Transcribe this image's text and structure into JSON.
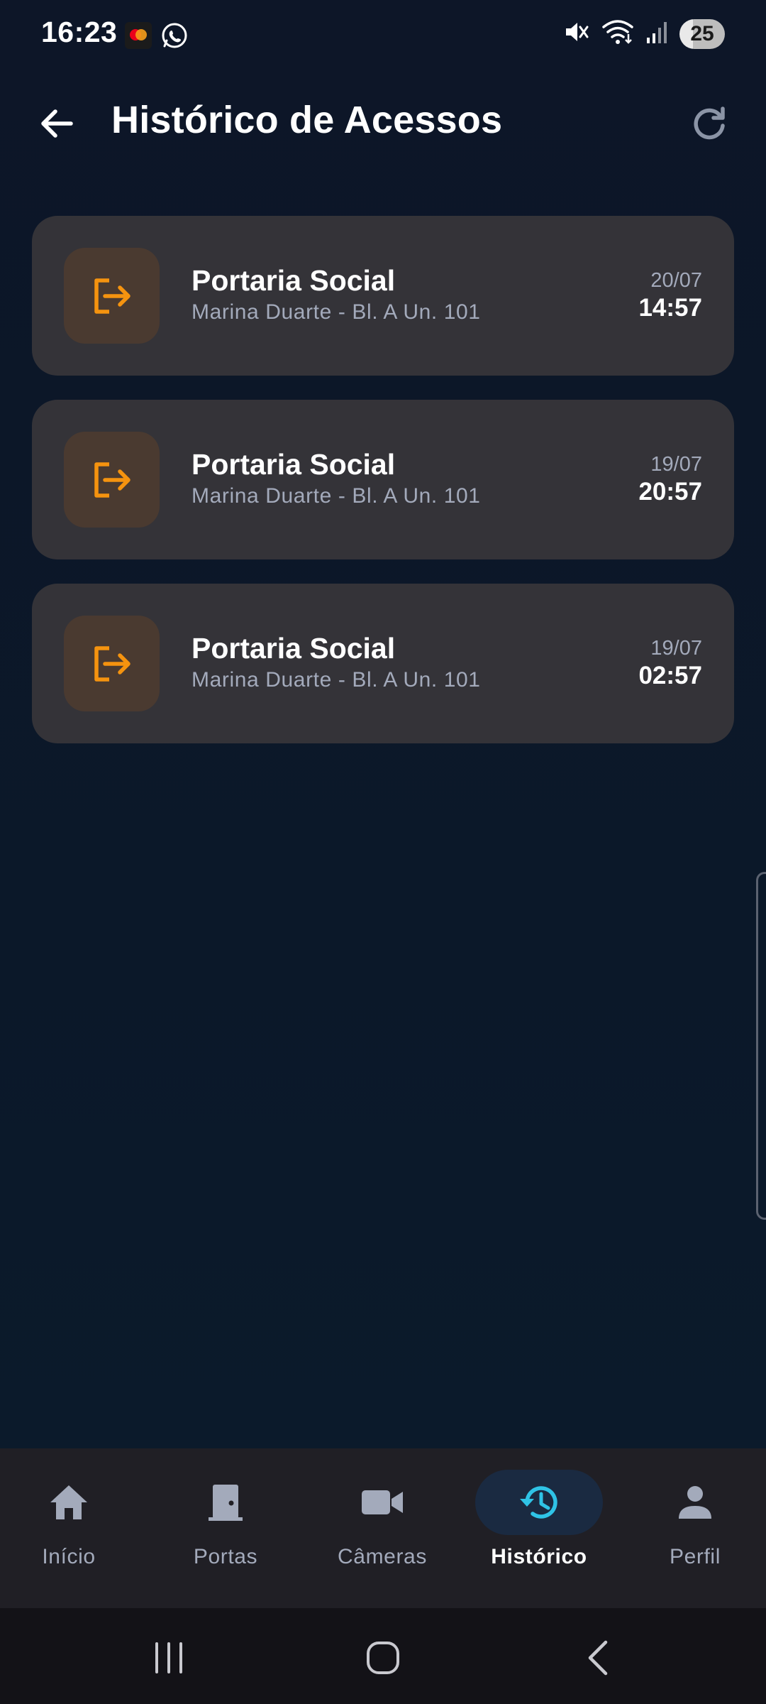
{
  "status_bar": {
    "time": "16:23",
    "battery": "25",
    "icons": [
      "mastercard-icon",
      "whatsapp-icon",
      "mute-icon",
      "wifi-icon",
      "signal-icon",
      "battery-icon"
    ]
  },
  "header": {
    "title": "Histórico de Acessos",
    "back_icon": "arrow-left-icon",
    "refresh_icon": "refresh-icon"
  },
  "access_list": [
    {
      "title": "Portaria Social",
      "subtitle": "Marina Duarte - Bl. A Un. 101",
      "date": "20/07",
      "time": "14:57",
      "icon": "exit-icon"
    },
    {
      "title": "Portaria Social",
      "subtitle": "Marina Duarte - Bl. A Un. 101",
      "date": "19/07",
      "time": "20:57",
      "icon": "exit-icon"
    },
    {
      "title": "Portaria Social",
      "subtitle": "Marina Duarte - Bl. A Un. 101",
      "date": "19/07",
      "time": "02:57",
      "icon": "exit-icon"
    }
  ],
  "bottom_nav": {
    "active": "Histórico",
    "items": [
      {
        "label": "Início",
        "icon": "home-icon"
      },
      {
        "label": "Portas",
        "icon": "door-icon"
      },
      {
        "label": "Câmeras",
        "icon": "videocam-icon"
      },
      {
        "label": "Histórico",
        "icon": "history-icon"
      },
      {
        "label": "Perfil",
        "icon": "person-icon"
      }
    ]
  },
  "colors": {
    "background": "#0c1526",
    "card": "#343338",
    "accent_orange": "#f5930f",
    "accent_cyan": "#2fc3e6",
    "muted_text": "#a3aabb",
    "nav_background": "#201f25"
  }
}
